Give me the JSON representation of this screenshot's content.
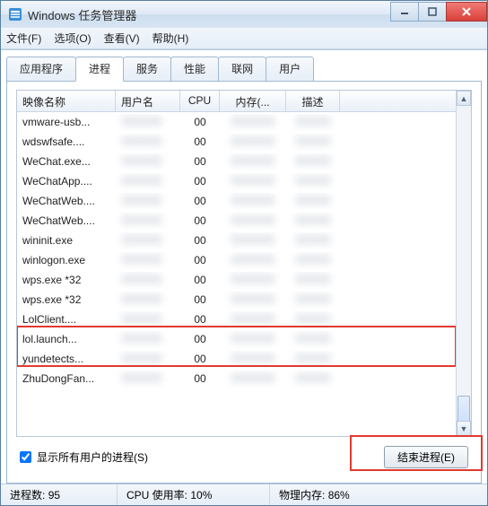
{
  "window": {
    "title": "Windows 任务管理器"
  },
  "menu": {
    "file": "文件(F)",
    "options": "选项(O)",
    "view": "查看(V)",
    "help": "帮助(H)"
  },
  "tabs": {
    "apps": "应用程序",
    "processes": "进程",
    "services": "服务",
    "performance": "性能",
    "networking": "联网",
    "users": "用户"
  },
  "columns": {
    "image_name": "映像名称",
    "user": "用户名",
    "cpu": "CPU",
    "memory": "内存(...",
    "description": "描述"
  },
  "rows": [
    {
      "name": "vmware-usb...",
      "cpu": "00"
    },
    {
      "name": "wdswfsafe....",
      "cpu": "00"
    },
    {
      "name": "WeChat.exe...",
      "cpu": "00"
    },
    {
      "name": "WeChatApp....",
      "cpu": "00"
    },
    {
      "name": "WeChatWeb....",
      "cpu": "00"
    },
    {
      "name": "WeChatWeb....",
      "cpu": "00"
    },
    {
      "name": "wininit.exe",
      "cpu": "00"
    },
    {
      "name": "winlogon.exe",
      "cpu": "00"
    },
    {
      "name": "wps.exe *32",
      "cpu": "00"
    },
    {
      "name": "wps.exe *32",
      "cpu": "00"
    },
    {
      "name": "LolClient....",
      "cpu": "00"
    },
    {
      "name": "lol.launch...",
      "cpu": "00"
    },
    {
      "name": "yundetects...",
      "cpu": "00"
    },
    {
      "name": "ZhuDongFan...",
      "cpu": "00"
    }
  ],
  "footer": {
    "show_all_label": "显示所有用户的进程(S)",
    "end_process_label": "结束进程(E)"
  },
  "status": {
    "process_count_label": "进程数:",
    "process_count_value": "95",
    "cpu_usage_label": "CPU 使用率:",
    "cpu_usage_value": "10%",
    "phys_mem_label": "物理内存:",
    "phys_mem_value": "86%"
  }
}
